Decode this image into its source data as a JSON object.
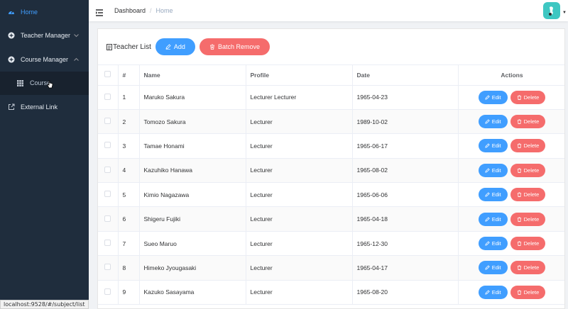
{
  "sidebar": {
    "home_label": "Home",
    "teacher_manager_label": "Teacher Manager",
    "course_manager_label": "Course Manager",
    "course_label": "Course",
    "external_link_label": "External Link"
  },
  "header": {
    "breadcrumb": [
      "Dashboard",
      "Home"
    ],
    "separator": "/"
  },
  "toolbar": {
    "title": "Teacher List",
    "add_label": "Add",
    "batch_remove_label": "Batch Remove"
  },
  "table": {
    "columns": [
      "#",
      "Name",
      "Profile",
      "Date",
      "Actions"
    ],
    "edit_label": "Edit",
    "delete_label": "Delete",
    "rows": [
      {
        "idx": "1",
        "name": "Maruko Sakura",
        "profile": "Lecturer Lecturer",
        "date": "1965-04-23"
      },
      {
        "idx": "2",
        "name": "Tomozo Sakura",
        "profile": "Lecturer",
        "date": "1989-10-02"
      },
      {
        "idx": "3",
        "name": "Tamae Honami",
        "profile": "Lecturer",
        "date": "1965-06-17"
      },
      {
        "idx": "4",
        "name": "Kazuhiko Hanawa",
        "profile": "Lecturer",
        "date": "1965-08-02"
      },
      {
        "idx": "5",
        "name": "Kimio Nagazawa",
        "profile": "Lecturer",
        "date": "1965-06-06"
      },
      {
        "idx": "6",
        "name": "Shigeru Fujiki",
        "profile": "Lecturer",
        "date": "1965-04-18"
      },
      {
        "idx": "7",
        "name": "Sueo Maruo",
        "profile": "Lecturer",
        "date": "1965-12-30"
      },
      {
        "idx": "8",
        "name": "Himeko Jyougasaki",
        "profile": "Lecturer",
        "date": "1965-04-17"
      },
      {
        "idx": "9",
        "name": "Kazuko Sasayama",
        "profile": "Lecturer",
        "date": "1965-08-20"
      }
    ]
  },
  "statusbar": {
    "url": "localhost:9528/#/subject/list"
  },
  "colors": {
    "primary": "#409eff",
    "danger": "#f56c6c",
    "sidebar_bg": "#1f2d3d",
    "avatar_bg": "#3ec7c2"
  }
}
